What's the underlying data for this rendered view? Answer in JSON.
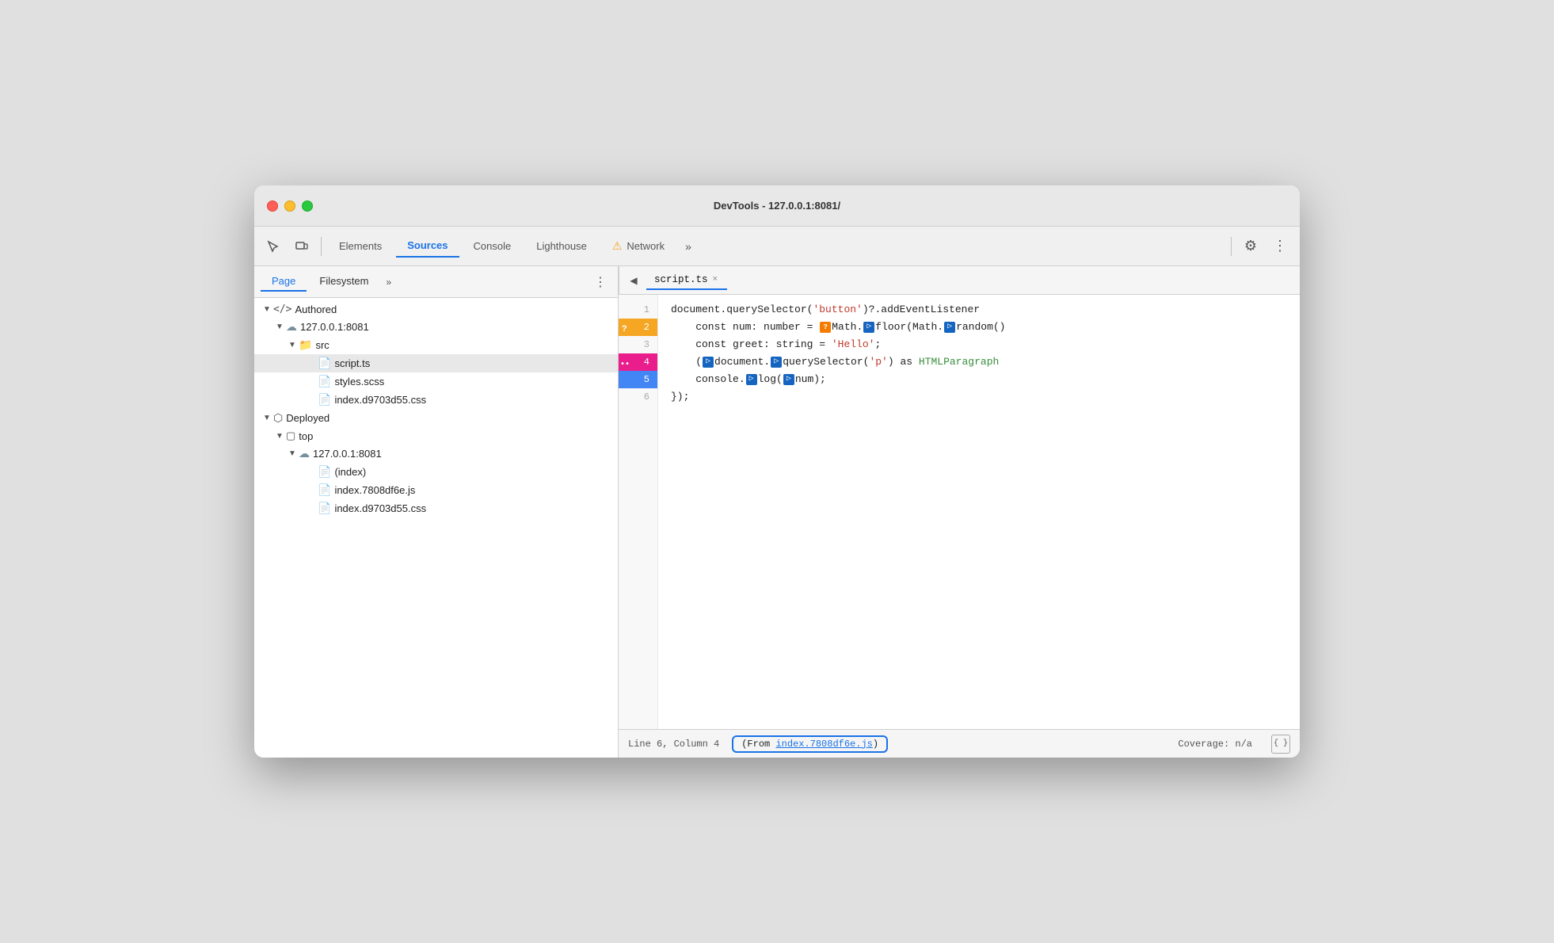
{
  "window": {
    "title": "DevTools - 127.0.0.1:8081/"
  },
  "toolbar": {
    "tabs": [
      {
        "id": "elements",
        "label": "Elements",
        "active": false
      },
      {
        "id": "sources",
        "label": "Sources",
        "active": true
      },
      {
        "id": "console",
        "label": "Console",
        "active": false
      },
      {
        "id": "lighthouse",
        "label": "Lighthouse",
        "active": false
      },
      {
        "id": "network",
        "label": "Network",
        "active": false
      }
    ],
    "more_label": "»",
    "gear_label": "⚙",
    "dots_label": "⋮"
  },
  "subtoolbar": {
    "tabs": [
      {
        "id": "page",
        "label": "Page",
        "active": true
      },
      {
        "id": "filesystem",
        "label": "Filesystem",
        "active": false
      }
    ],
    "more_label": "»",
    "dots_label": "⋮"
  },
  "filetab": {
    "back_icon": "◀",
    "filename": "script.ts",
    "close_icon": "×"
  },
  "filetree": {
    "sections": [
      {
        "id": "authored",
        "label": "Authored",
        "icon": "</>",
        "expanded": true,
        "children": [
          {
            "id": "server1",
            "label": "127.0.0.1:8081",
            "icon": "☁",
            "expanded": true,
            "children": [
              {
                "id": "src",
                "label": "src",
                "icon": "📁",
                "icon_color": "#f57c00",
                "expanded": true,
                "children": [
                  {
                    "id": "scriptts",
                    "label": "script.ts",
                    "icon": "📄",
                    "icon_color": "#f5a623",
                    "selected": true
                  },
                  {
                    "id": "stylesscss",
                    "label": "styles.scss",
                    "icon": "📄",
                    "icon_color": "#607d8b"
                  },
                  {
                    "id": "indexcss",
                    "label": "index.d9703d55.css",
                    "icon": "📄",
                    "icon_color": "#7b1fa2"
                  }
                ]
              }
            ]
          }
        ]
      },
      {
        "id": "deployed",
        "label": "Deployed",
        "icon": "⬡",
        "expanded": true,
        "children": [
          {
            "id": "top",
            "label": "top",
            "icon": "▢",
            "expanded": true,
            "children": [
              {
                "id": "server2",
                "label": "127.0.0.1:8081",
                "icon": "☁",
                "expanded": true,
                "children": [
                  {
                    "id": "index",
                    "label": "(index)",
                    "icon": "📄",
                    "icon_color": "#9e9e9e"
                  },
                  {
                    "id": "indexjs",
                    "label": "index.7808df6e.js",
                    "icon": "📄",
                    "icon_color": "#f5a623"
                  },
                  {
                    "id": "indexcss2",
                    "label": "index.d9703d55.css",
                    "icon": "📄",
                    "icon_color": "#7b1fa2"
                  }
                ]
              }
            ]
          }
        ]
      }
    ]
  },
  "editor": {
    "lines": [
      {
        "number": "1",
        "bp": null,
        "content_html": "document.querySelector(<span class='c-string'>'button'</span>)?.addEventListener"
      },
      {
        "number": "2",
        "bp": "question",
        "bp_label": "?",
        "content_html": "    const num: number = <span class='type-badge type-badge-question'>?</span>Math.<span class='type-badge type-badge-blue'>▷</span>floor(Math.<span class='type-badge type-badge-blue'>▷</span>random()"
      },
      {
        "number": "3",
        "bp": null,
        "content_html": "    const greet: string = <span class='c-string'>'Hello'</span>;"
      },
      {
        "number": "4",
        "bp": "dots",
        "bp_label": "••",
        "content_html": "    (<span class='type-badge type-badge-blue'>▷</span>document.<span class='type-badge type-badge-blue'>▷</span>querySelector(<span class='c-string'>'p'</span>) as HTMLParagraph"
      },
      {
        "number": "5",
        "bp": "blue",
        "bp_label": "",
        "content_html": "    console.<span class='type-badge type-badge-blue'>▷</span>log(<span class='type-badge type-badge-blue'>▷</span>num);"
      },
      {
        "number": "6",
        "bp": null,
        "content_html": "});"
      }
    ]
  },
  "statusbar": {
    "position": "Line 6, Column 4",
    "source_text": "(From ",
    "source_link": "index.7808df6e.js",
    "source_suffix": ")",
    "coverage": "Coverage: n/a"
  }
}
